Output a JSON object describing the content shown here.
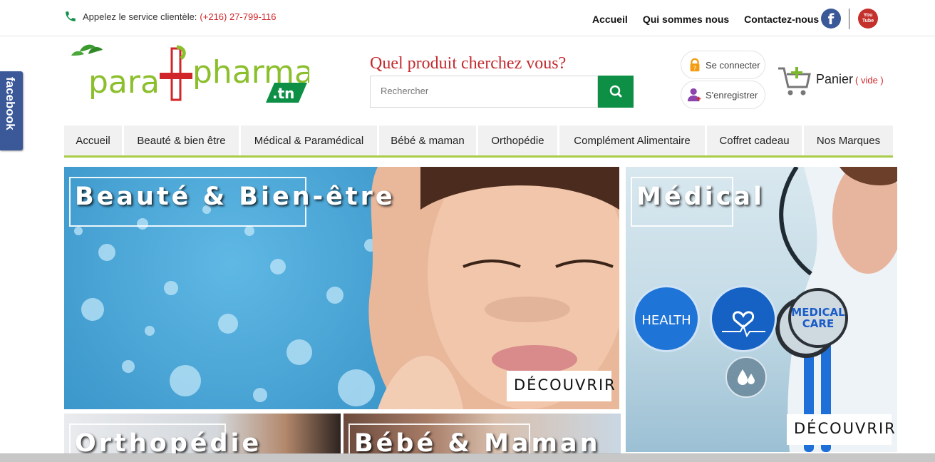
{
  "topbar": {
    "phone_label": "Appelez le service clientèle:",
    "phone_number": "(+216) 27-799-116",
    "links": [
      "Accueil",
      "Qui sommes nous",
      "Contactez-nous"
    ],
    "social_facebook": "f",
    "social_youtube_1": "You",
    "social_youtube_2": "Tube"
  },
  "side": {
    "facebook_tab": "facebook"
  },
  "logo": {
    "part1": "para",
    "part2": "pharma",
    "part3": ".tn"
  },
  "search": {
    "title": "Quel produit cherchez vous?",
    "placeholder": "Rechercher"
  },
  "account": {
    "login": "Se connecter",
    "register": "S'enregistrer"
  },
  "cart": {
    "label": "Panier",
    "status": "( vide )"
  },
  "nav": {
    "items": [
      "Accueil",
      "Beauté & bien être",
      "Médical & Paramédical",
      "Bébé & maman",
      "Orthopédie",
      "Complément Alimentaire",
      "Coffret cadeau",
      "Nos Marques"
    ]
  },
  "banners": {
    "beauty": {
      "title": "Beauté & Bien-être",
      "cta": "DÉCOUVRIR"
    },
    "medical": {
      "title": "Médical",
      "cta": "DÉCOUVRIR",
      "badge1": "HEALTH",
      "badge2_l1": "MEDICAL",
      "badge2_l2": "CARE"
    },
    "ortho": {
      "title": "Orthopédie"
    },
    "baby": {
      "title": "Bébé & Maman"
    }
  },
  "colors": {
    "brand_green": "#0d8f46",
    "accent_red": "#d0262a",
    "nav_underline": "#a8cc48"
  }
}
